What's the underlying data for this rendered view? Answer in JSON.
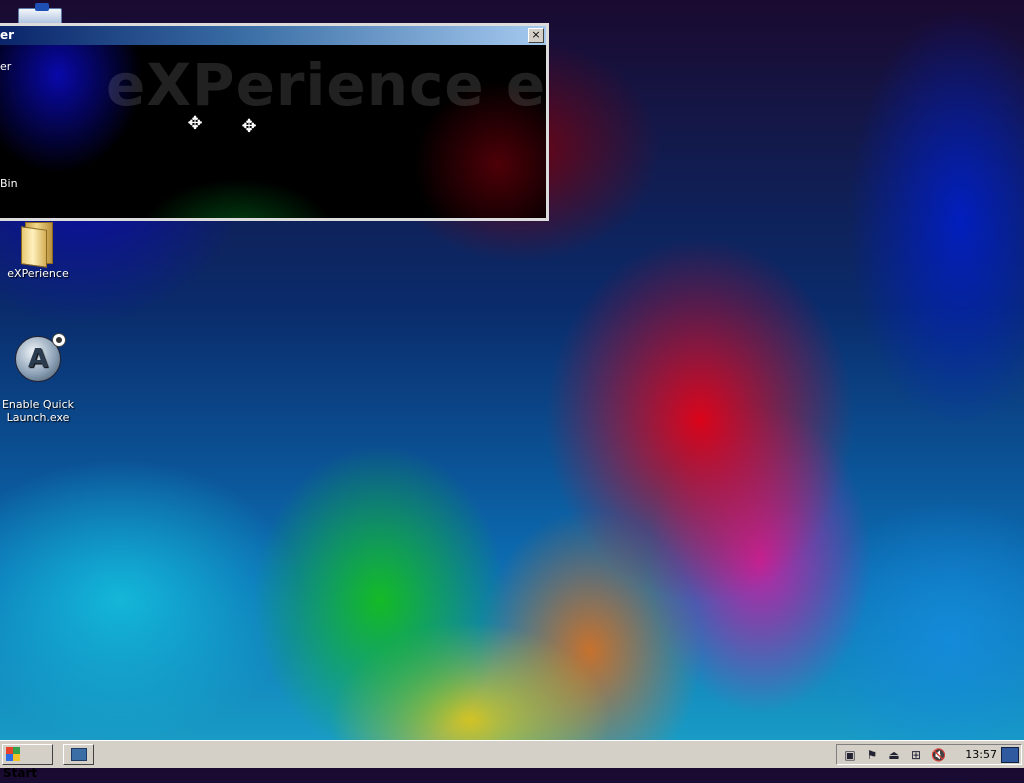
{
  "window": {
    "title_fragment": "er",
    "close_glyph": "×",
    "watermark": "eXPerience e",
    "side_labels": [
      "er",
      "Bin"
    ]
  },
  "desktop": {
    "icons": [
      {
        "label": "eXPerience",
        "icon": "folder-icon"
      },
      {
        "label": "Enable Quick\nLaunch.exe",
        "icon": "app-launch-icon"
      }
    ]
  },
  "taskbar": {
    "start_label": "Start",
    "quick_launch_icon": "show-desktop-icon",
    "tray_icons": [
      "network-icon",
      "flag-icon",
      "usb-safe-remove-icon",
      "lan-icon",
      "volume-muted-icon"
    ],
    "clock": "13:57",
    "show_desktop_icon": "desktop-icon"
  },
  "colors": {
    "taskbar": "#d4d0c8",
    "titlebar_start": "#0a246a",
    "titlebar_end": "#a6caf0"
  }
}
